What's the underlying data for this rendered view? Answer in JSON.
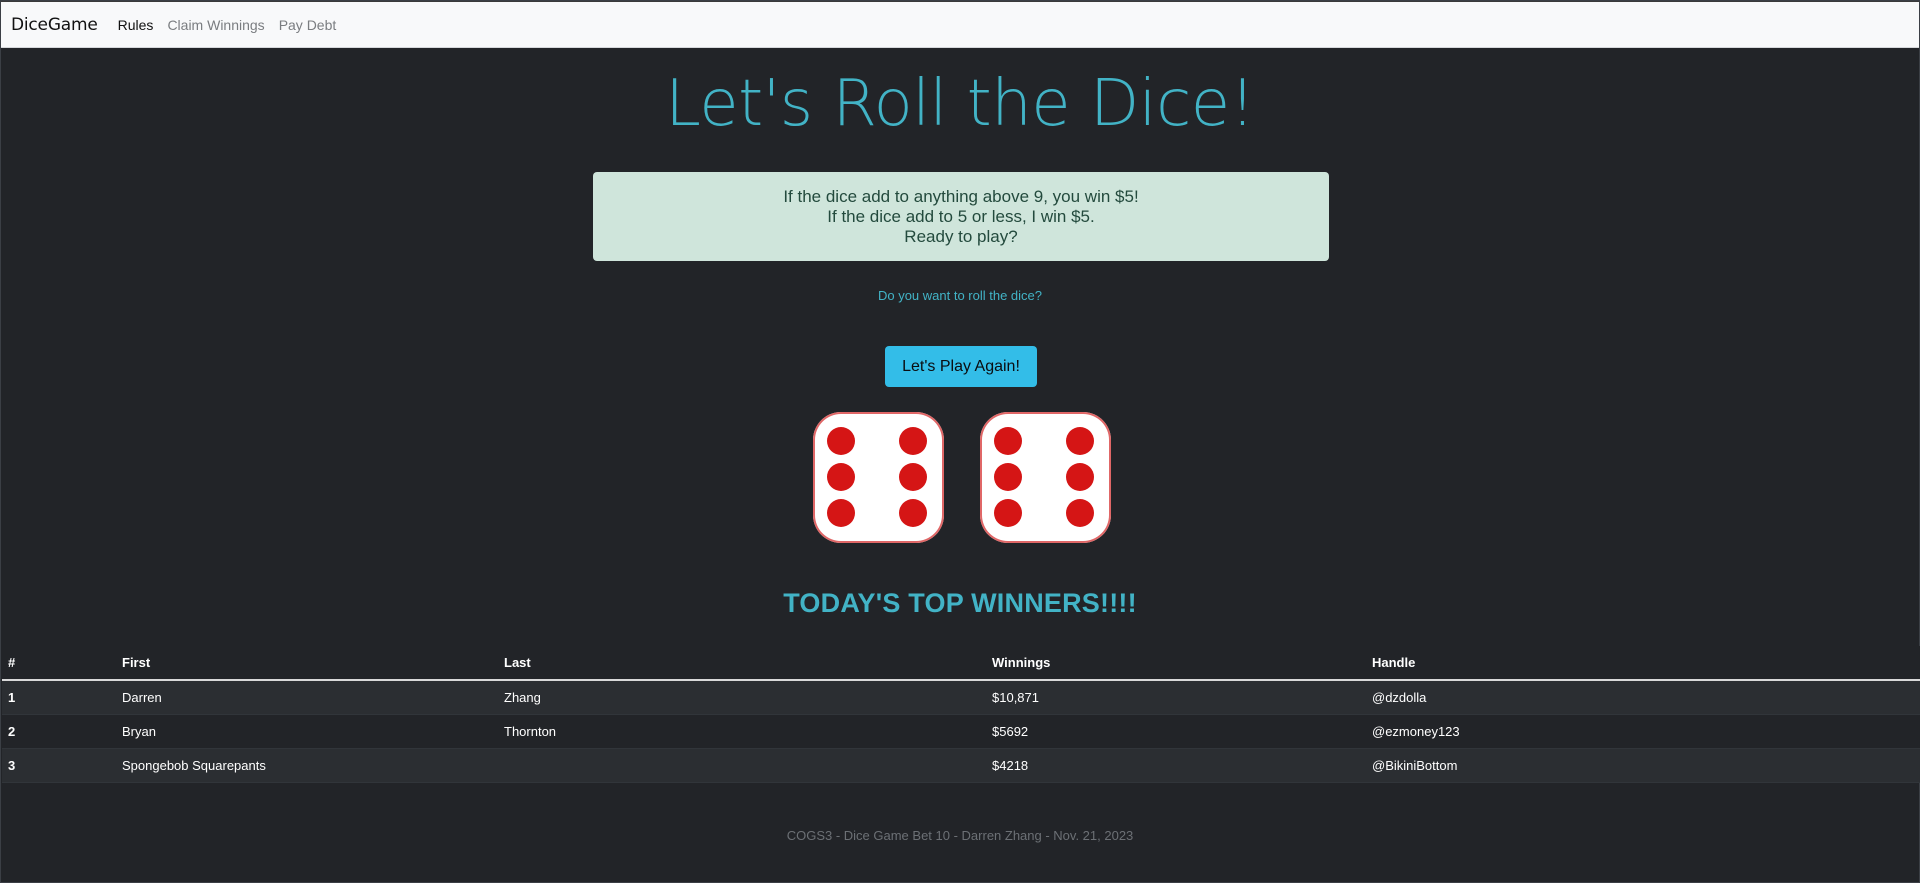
{
  "nav": {
    "brand": "DiceGame",
    "links": [
      "Rules",
      "Claim Winnings",
      "Pay Debt"
    ]
  },
  "main": {
    "title": "Let's Roll the Dice!",
    "rules": [
      "If the dice add to anything above 9, you win $5!",
      "If the dice add to 5 or less, I win $5.",
      "Ready to play?"
    ],
    "question": "Do you want to roll the dice?",
    "play_button": "Let's Play Again!"
  },
  "dice": {
    "values": [
      6,
      6
    ],
    "face_color": "#ffffff",
    "pip_color": "#d51515"
  },
  "winners": {
    "title": "TODAY'S TOP WINNERS!!!!",
    "headers": [
      "#",
      "First",
      "Last",
      "Winnings",
      "Handle"
    ],
    "rows": [
      [
        "1",
        "Darren",
        "Zhang",
        "$10,871",
        "@dzdolla"
      ],
      [
        "2",
        "Bryan",
        "Thornton",
        "$5692",
        "@ezmoney123"
      ],
      [
        "3",
        "Spongebob Squarepants",
        "",
        "$4218",
        "@BikiniBottom"
      ]
    ]
  },
  "footer": "COGS3 - Dice Game Bet 10 - Darren Zhang - Nov. 21, 2023",
  "colors": {
    "accent": "#42b3c6",
    "button": "#33bde8",
    "background": "#222428",
    "rules_box": "#cfe5db"
  }
}
